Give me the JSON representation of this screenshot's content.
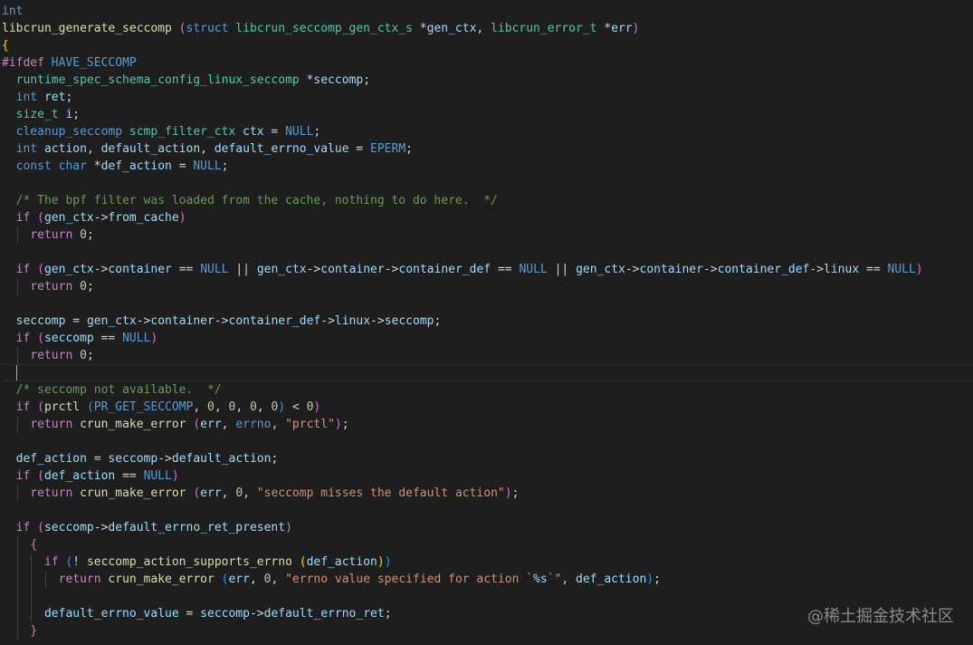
{
  "editor": {
    "theme_background": "#1e1e1e",
    "current_line": 21,
    "lines": [
      {
        "indent": 0,
        "tokens": [
          [
            "keyword",
            "int"
          ]
        ]
      },
      {
        "indent": 0,
        "tokens": [
          [
            "func",
            "libcrun_generate_seccomp"
          ],
          [
            "plain",
            " "
          ],
          [
            "brace2",
            "("
          ],
          [
            "keyword",
            "struct"
          ],
          [
            "plain",
            " "
          ],
          [
            "type",
            "libcrun_seccomp_gen_ctx_s"
          ],
          [
            "plain",
            " *"
          ],
          [
            "var",
            "gen_ctx"
          ],
          [
            "plain",
            ", "
          ],
          [
            "type",
            "libcrun_error_t"
          ],
          [
            "plain",
            " *"
          ],
          [
            "var",
            "err"
          ],
          [
            "brace2",
            ")"
          ]
        ]
      },
      {
        "indent": 0,
        "tokens": [
          [
            "brace1",
            "{"
          ]
        ]
      },
      {
        "indent": 0,
        "tokens": [
          [
            "pre",
            "#ifdef"
          ],
          [
            "plain",
            " "
          ],
          [
            "macro",
            "HAVE_SECCOMP"
          ]
        ]
      },
      {
        "indent": 1,
        "tokens": [
          [
            "type",
            "runtime_spec_schema_config_linux_seccomp"
          ],
          [
            "plain",
            " *"
          ],
          [
            "var",
            "seccomp"
          ],
          [
            "plain",
            ";"
          ]
        ]
      },
      {
        "indent": 1,
        "tokens": [
          [
            "keyword",
            "int"
          ],
          [
            "plain",
            " "
          ],
          [
            "var",
            "ret"
          ],
          [
            "plain",
            ";"
          ]
        ]
      },
      {
        "indent": 1,
        "tokens": [
          [
            "type",
            "size_t"
          ],
          [
            "plain",
            " "
          ],
          [
            "var",
            "i"
          ],
          [
            "plain",
            ";"
          ]
        ]
      },
      {
        "indent": 1,
        "tokens": [
          [
            "macro",
            "cleanup_seccomp"
          ],
          [
            "plain",
            " "
          ],
          [
            "type",
            "scmp_filter_ctx"
          ],
          [
            "plain",
            " "
          ],
          [
            "var",
            "ctx"
          ],
          [
            "plain",
            " = "
          ],
          [
            "macro",
            "NULL"
          ],
          [
            "plain",
            ";"
          ]
        ]
      },
      {
        "indent": 1,
        "tokens": [
          [
            "keyword",
            "int"
          ],
          [
            "plain",
            " "
          ],
          [
            "var",
            "action"
          ],
          [
            "plain",
            ", "
          ],
          [
            "var",
            "default_action"
          ],
          [
            "plain",
            ", "
          ],
          [
            "var",
            "default_errno_value"
          ],
          [
            "plain",
            " = "
          ],
          [
            "macro",
            "EPERM"
          ],
          [
            "plain",
            ";"
          ]
        ]
      },
      {
        "indent": 1,
        "tokens": [
          [
            "keyword",
            "const"
          ],
          [
            "plain",
            " "
          ],
          [
            "keyword",
            "char"
          ],
          [
            "plain",
            " *"
          ],
          [
            "var",
            "def_action"
          ],
          [
            "plain",
            " = "
          ],
          [
            "macro",
            "NULL"
          ],
          [
            "plain",
            ";"
          ]
        ]
      },
      {
        "indent": 0,
        "tokens": []
      },
      {
        "indent": 1,
        "tokens": [
          [
            "comment",
            "/* The bpf filter was loaded from the cache, nothing to do here.  */"
          ]
        ]
      },
      {
        "indent": 1,
        "tokens": [
          [
            "control",
            "if"
          ],
          [
            "plain",
            " "
          ],
          [
            "brace2",
            "("
          ],
          [
            "var",
            "gen_ctx"
          ],
          [
            "plain",
            "->"
          ],
          [
            "var",
            "from_cache"
          ],
          [
            "brace2",
            ")"
          ]
        ]
      },
      {
        "indent": 2,
        "tokens": [
          [
            "control",
            "return"
          ],
          [
            "plain",
            " "
          ],
          [
            "number",
            "0"
          ],
          [
            "plain",
            ";"
          ]
        ]
      },
      {
        "indent": 0,
        "tokens": []
      },
      {
        "indent": 1,
        "tokens": [
          [
            "control",
            "if"
          ],
          [
            "plain",
            " "
          ],
          [
            "brace2",
            "("
          ],
          [
            "var",
            "gen_ctx"
          ],
          [
            "plain",
            "->"
          ],
          [
            "var",
            "container"
          ],
          [
            "plain",
            " == "
          ],
          [
            "macro",
            "NULL"
          ],
          [
            "plain",
            " || "
          ],
          [
            "var",
            "gen_ctx"
          ],
          [
            "plain",
            "->"
          ],
          [
            "var",
            "container"
          ],
          [
            "plain",
            "->"
          ],
          [
            "var",
            "container_def"
          ],
          [
            "plain",
            " == "
          ],
          [
            "macro",
            "NULL"
          ],
          [
            "plain",
            " || "
          ],
          [
            "var",
            "gen_ctx"
          ],
          [
            "plain",
            "->"
          ],
          [
            "var",
            "container"
          ],
          [
            "plain",
            "->"
          ],
          [
            "var",
            "container_def"
          ],
          [
            "plain",
            "->"
          ],
          [
            "var",
            "linux"
          ],
          [
            "plain",
            " == "
          ],
          [
            "macro",
            "NULL"
          ],
          [
            "brace2",
            ")"
          ]
        ]
      },
      {
        "indent": 2,
        "tokens": [
          [
            "control",
            "return"
          ],
          [
            "plain",
            " "
          ],
          [
            "number",
            "0"
          ],
          [
            "plain",
            ";"
          ]
        ]
      },
      {
        "indent": 0,
        "tokens": []
      },
      {
        "indent": 1,
        "tokens": [
          [
            "var",
            "seccomp"
          ],
          [
            "plain",
            " = "
          ],
          [
            "var",
            "gen_ctx"
          ],
          [
            "plain",
            "->"
          ],
          [
            "var",
            "container"
          ],
          [
            "plain",
            "->"
          ],
          [
            "var",
            "container_def"
          ],
          [
            "plain",
            "->"
          ],
          [
            "var",
            "linux"
          ],
          [
            "plain",
            "->"
          ],
          [
            "var",
            "seccomp"
          ],
          [
            "plain",
            ";"
          ]
        ]
      },
      {
        "indent": 1,
        "tokens": [
          [
            "control",
            "if"
          ],
          [
            "plain",
            " "
          ],
          [
            "brace2",
            "("
          ],
          [
            "var",
            "seccomp"
          ],
          [
            "plain",
            " == "
          ],
          [
            "macro",
            "NULL"
          ],
          [
            "brace2",
            ")"
          ]
        ]
      },
      {
        "indent": 2,
        "tokens": [
          [
            "control",
            "return"
          ],
          [
            "plain",
            " "
          ],
          [
            "number",
            "0"
          ],
          [
            "plain",
            ";"
          ]
        ]
      },
      {
        "indent": 1,
        "tokens": []
      },
      {
        "indent": 1,
        "tokens": [
          [
            "comment",
            "/* seccomp not available.  */"
          ]
        ]
      },
      {
        "indent": 1,
        "tokens": [
          [
            "control",
            "if"
          ],
          [
            "plain",
            " "
          ],
          [
            "brace2",
            "("
          ],
          [
            "func",
            "prctl"
          ],
          [
            "plain",
            " "
          ],
          [
            "brace3",
            "("
          ],
          [
            "macro",
            "PR_GET_SECCOMP"
          ],
          [
            "plain",
            ", "
          ],
          [
            "number",
            "0"
          ],
          [
            "plain",
            ", "
          ],
          [
            "number",
            "0"
          ],
          [
            "plain",
            ", "
          ],
          [
            "number",
            "0"
          ],
          [
            "plain",
            ", "
          ],
          [
            "number",
            "0"
          ],
          [
            "brace3",
            ")"
          ],
          [
            "plain",
            " < "
          ],
          [
            "number",
            "0"
          ],
          [
            "brace2",
            ")"
          ]
        ]
      },
      {
        "indent": 2,
        "tokens": [
          [
            "control",
            "return"
          ],
          [
            "plain",
            " "
          ],
          [
            "func",
            "crun_make_error"
          ],
          [
            "plain",
            " "
          ],
          [
            "brace2",
            "("
          ],
          [
            "var",
            "err"
          ],
          [
            "plain",
            ", "
          ],
          [
            "macro",
            "errno"
          ],
          [
            "plain",
            ", "
          ],
          [
            "string",
            "\"prctl\""
          ],
          [
            "brace2",
            ")"
          ],
          [
            "plain",
            ";"
          ]
        ]
      },
      {
        "indent": 0,
        "tokens": []
      },
      {
        "indent": 1,
        "tokens": [
          [
            "var",
            "def_action"
          ],
          [
            "plain",
            " = "
          ],
          [
            "var",
            "seccomp"
          ],
          [
            "plain",
            "->"
          ],
          [
            "var",
            "default_action"
          ],
          [
            "plain",
            ";"
          ]
        ]
      },
      {
        "indent": 1,
        "tokens": [
          [
            "control",
            "if"
          ],
          [
            "plain",
            " "
          ],
          [
            "brace2",
            "("
          ],
          [
            "var",
            "def_action"
          ],
          [
            "plain",
            " == "
          ],
          [
            "macro",
            "NULL"
          ],
          [
            "brace2",
            ")"
          ]
        ]
      },
      {
        "indent": 2,
        "tokens": [
          [
            "control",
            "return"
          ],
          [
            "plain",
            " "
          ],
          [
            "func",
            "crun_make_error"
          ],
          [
            "plain",
            " "
          ],
          [
            "brace2",
            "("
          ],
          [
            "var",
            "err"
          ],
          [
            "plain",
            ", "
          ],
          [
            "number",
            "0"
          ],
          [
            "plain",
            ", "
          ],
          [
            "string",
            "\"seccomp misses the default action\""
          ],
          [
            "brace2",
            ")"
          ],
          [
            "plain",
            ";"
          ]
        ]
      },
      {
        "indent": 0,
        "tokens": []
      },
      {
        "indent": 1,
        "tokens": [
          [
            "control",
            "if"
          ],
          [
            "plain",
            " "
          ],
          [
            "brace2",
            "("
          ],
          [
            "var",
            "seccomp"
          ],
          [
            "plain",
            "->"
          ],
          [
            "var",
            "default_errno_ret_present"
          ],
          [
            "brace2",
            ")"
          ]
        ]
      },
      {
        "indent": 2,
        "tokens": [
          [
            "brace2",
            "{"
          ]
        ]
      },
      {
        "indent": 3,
        "tokens": [
          [
            "control",
            "if"
          ],
          [
            "plain",
            " "
          ],
          [
            "brace3",
            "("
          ],
          [
            "plain",
            "! "
          ],
          [
            "func",
            "seccomp_action_supports_errno"
          ],
          [
            "plain",
            " "
          ],
          [
            "brace1",
            "("
          ],
          [
            "var",
            "def_action"
          ],
          [
            "brace1",
            ")"
          ],
          [
            "brace3",
            ")"
          ]
        ]
      },
      {
        "indent": 4,
        "tokens": [
          [
            "control",
            "return"
          ],
          [
            "plain",
            " "
          ],
          [
            "func",
            "crun_make_error"
          ],
          [
            "plain",
            " "
          ],
          [
            "brace3",
            "("
          ],
          [
            "var",
            "err"
          ],
          [
            "plain",
            ", "
          ],
          [
            "number",
            "0"
          ],
          [
            "plain",
            ", "
          ],
          [
            "string",
            "\"errno value specified for action `"
          ],
          [
            "format",
            "%s"
          ],
          [
            "string",
            "`\""
          ],
          [
            "plain",
            ", "
          ],
          [
            "var",
            "def_action"
          ],
          [
            "brace3",
            ")"
          ],
          [
            "plain",
            ";"
          ]
        ]
      },
      {
        "indent": 3,
        "tokens": []
      },
      {
        "indent": 3,
        "tokens": [
          [
            "var",
            "default_errno_value"
          ],
          [
            "plain",
            " = "
          ],
          [
            "var",
            "seccomp"
          ],
          [
            "plain",
            "->"
          ],
          [
            "var",
            "default_errno_ret"
          ],
          [
            "plain",
            ";"
          ]
        ]
      },
      {
        "indent": 2,
        "tokens": [
          [
            "brace2",
            "}"
          ]
        ]
      }
    ]
  },
  "watermark": {
    "text": "@稀土掘金技术社区"
  }
}
